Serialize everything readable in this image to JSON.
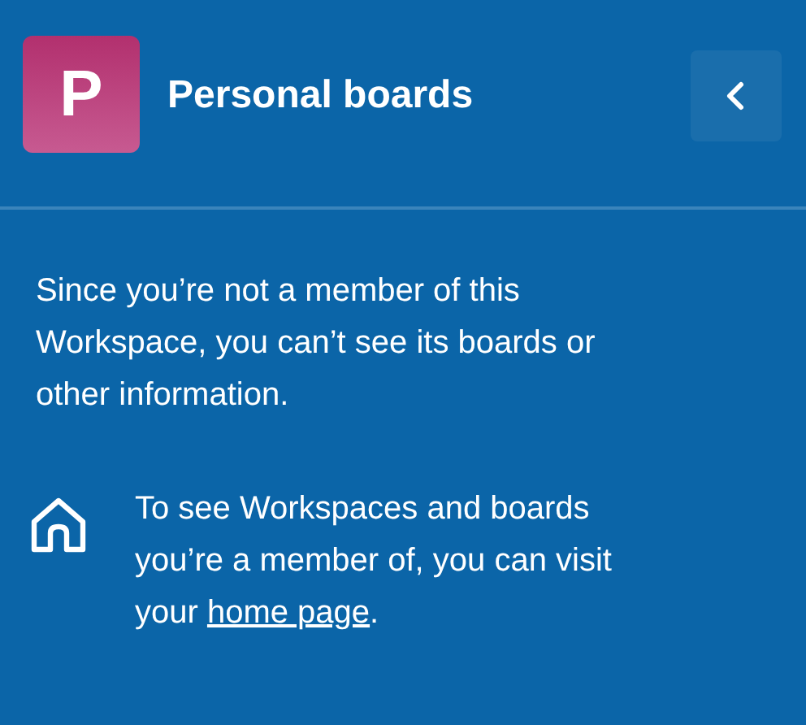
{
  "header": {
    "avatar_letter": "P",
    "title": "Personal boards"
  },
  "message": "Since you’re not a member of this Workspace, you can’t see its boards or other information.",
  "hint": {
    "before": "To see Workspaces and boards you’re a member of, you can visit your ",
    "link": "home page",
    "after": "."
  }
}
